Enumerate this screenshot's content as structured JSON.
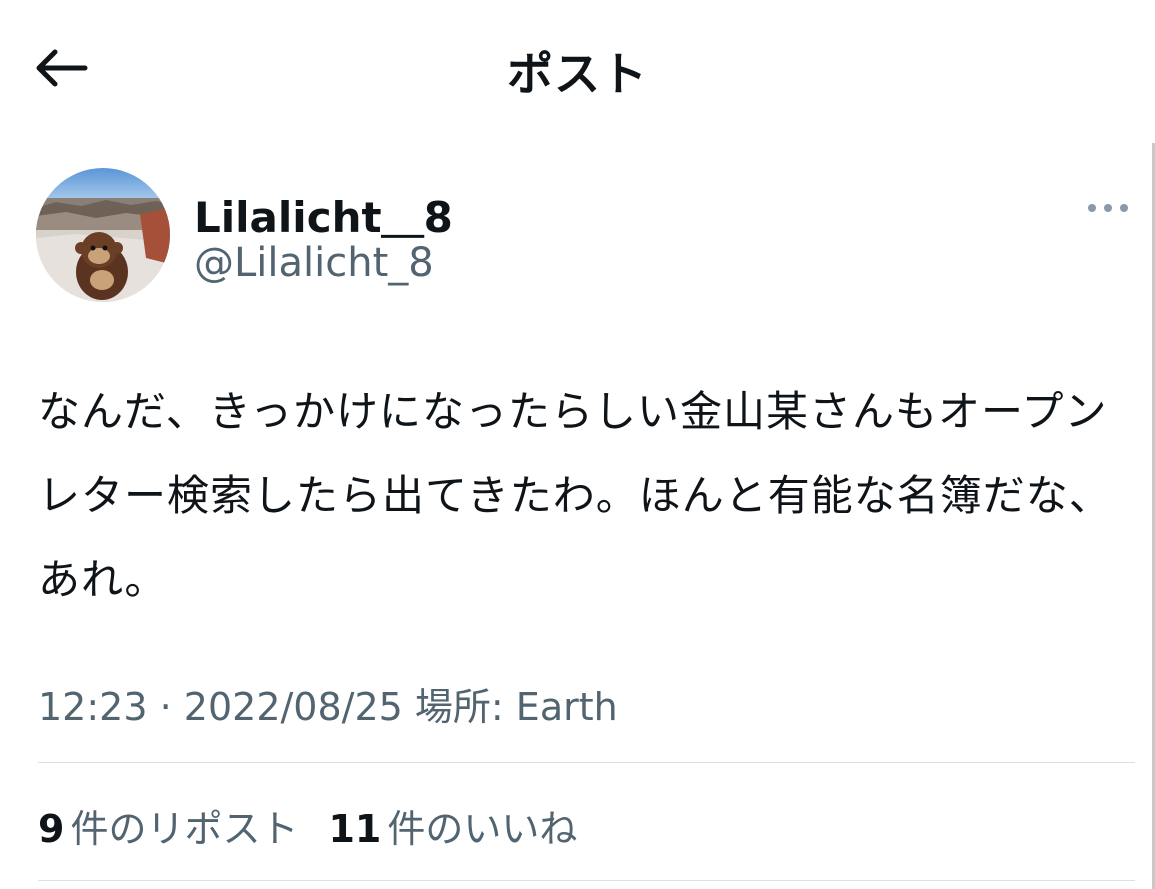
{
  "header": {
    "title": "ポスト",
    "back_icon": "arrow-left-icon"
  },
  "post": {
    "author": {
      "display_name": "Lilalicht＿8",
      "username": "@Lilalicht_8",
      "avatar": "avatar-image"
    },
    "more_icon": "more-horizontal-icon",
    "text": "なんだ、きっかけになったらしい金山某さんもオープンレター検索したら出てきたわ。ほんと有能な名簿だな、あれ。",
    "meta": {
      "time": "12:23",
      "separator": "·",
      "date": "2022/08/25",
      "location_label": "場所: Earth"
    },
    "stats": {
      "reposts_count": "9",
      "reposts_label": "件のリポスト",
      "likes_count": "11",
      "likes_label": "件のいいね"
    }
  },
  "colors": {
    "text_primary": "#0f1419",
    "text_secondary": "#536471",
    "divider": "#dcdfe3"
  }
}
